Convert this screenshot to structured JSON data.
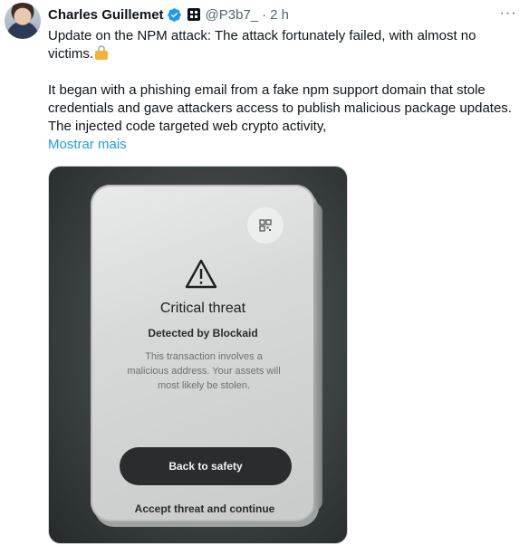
{
  "author": {
    "name": "Charles Guillemet",
    "handle": "@P3b7_",
    "separator": "·",
    "time": "2 h",
    "verified_color": "#1d9bf0",
    "avatar_icon": "profile-photo"
  },
  "menu": {
    "more_label": "···"
  },
  "tweet": {
    "paragraph1": "Update on the NPM attack: The attack fortunately failed, with almost no victims.",
    "paragraph2": "It began with a phishing email from a fake npm support domain that stole credentials and gave attackers access to publish malicious package updates. The injected code targeted web crypto activity,",
    "show_more": "Mostrar mais",
    "link_color": "#1d9bf0"
  },
  "media": {
    "title": "Critical threat",
    "detected_by": "Detected by Blockaid",
    "description": "This transaction involves a malicious address. Your assets will most likely be stolen.",
    "primary_button": "Back to safety",
    "secondary_button": "Accept threat and continue",
    "icons": [
      "qr-code-icon",
      "warning-triangle-icon"
    ]
  }
}
